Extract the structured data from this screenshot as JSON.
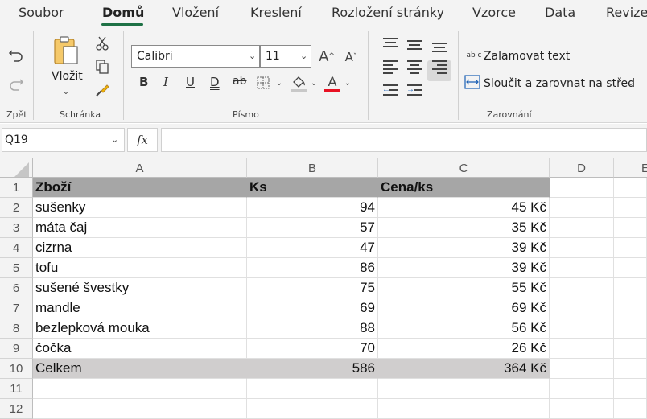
{
  "ribbon_tabs": [
    "Soubor",
    "Domů",
    "Vložení",
    "Kreslení",
    "Rozložení stránky",
    "Vzorce",
    "Data",
    "Revize"
  ],
  "active_tab": "Domů",
  "accent_color": "#1e7145",
  "groups": {
    "undo": {
      "label": "Zpět"
    },
    "clipboard": {
      "label": "Schránka",
      "paste_label": "Vložit"
    },
    "font": {
      "label": "Písmo",
      "font_name": "Calibri",
      "font_size": "11",
      "bold": "B",
      "italic": "I",
      "underline": "U",
      "double_underline": "D",
      "strikethrough": "ab",
      "font_color_letter": "A",
      "font_color": "#e81123"
    },
    "alignment": {
      "label": "Zarovnání",
      "wrap_text": "Zalamovat text",
      "wrap_icon_text": "ab c",
      "merge_center": "Sloučit a zarovnat na střed"
    }
  },
  "formula_bar": {
    "name_box": "Q19",
    "fx": "fx",
    "formula": ""
  },
  "columns": [
    "A",
    "B",
    "C",
    "D",
    "E"
  ],
  "rows": [
    "1",
    "2",
    "3",
    "4",
    "5",
    "6",
    "7",
    "8",
    "9",
    "10",
    "11",
    "12"
  ],
  "table": {
    "header": [
      "Zboží",
      "Ks",
      "Cena/ks"
    ],
    "items": [
      [
        "sušenky",
        "94",
        "45 Kč"
      ],
      [
        "máta čaj",
        "57",
        "35 Kč"
      ],
      [
        "cizrna",
        "47",
        "39 Kč"
      ],
      [
        "tofu",
        "86",
        "39 Kč"
      ],
      [
        "sušené švestky",
        "75",
        "55 Kč"
      ],
      [
        "mandle",
        "69",
        "69 Kč"
      ],
      [
        "bezlepková mouka",
        "88",
        "56 Kč"
      ],
      [
        "čočka",
        "70",
        "26 Kč"
      ]
    ],
    "total": [
      "Celkem",
      "586",
      "364 Kč"
    ]
  },
  "colors": {
    "header_fill": "#a6a6a6",
    "total_fill": "#d0cece"
  },
  "icons": [
    "undo-icon",
    "redo-icon",
    "paste-icon",
    "cut-icon",
    "copy-icon",
    "format-painter-icon",
    "grow-font-icon",
    "shrink-font-icon",
    "borders-icon",
    "fill-color-icon",
    "font-color-icon",
    "align-top-icon",
    "align-middle-icon",
    "align-bottom-icon",
    "align-left-icon",
    "align-center-icon",
    "align-right-icon",
    "decrease-indent-icon",
    "increase-indent-icon",
    "wrap-text-icon",
    "merge-center-icon"
  ]
}
